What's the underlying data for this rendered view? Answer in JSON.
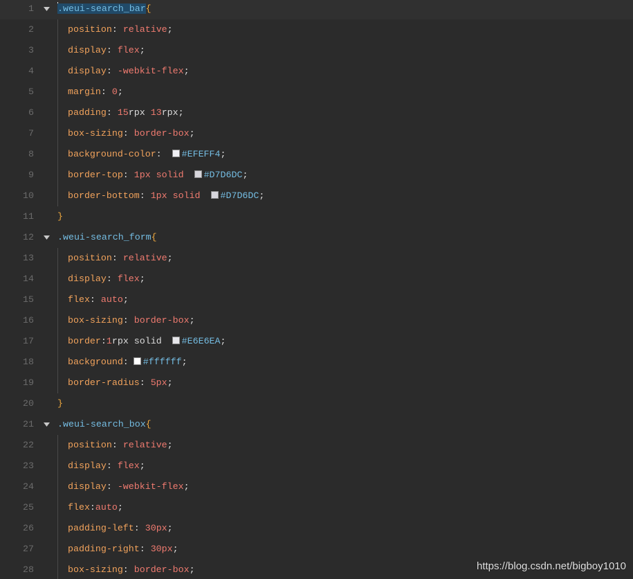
{
  "editor": {
    "theme": {
      "background": "#2b2b2b",
      "current_line": "#303030",
      "line_number": "#6b6b6b",
      "fold_arrow": "#c8c8c8",
      "indent_guide": "#4a4a4a",
      "selection": "#214a68",
      "tokens": {
        "selector": "#75bde3",
        "brace": "#efa93f",
        "property": "#f2a35c",
        "punctuation": "#dcdcdc",
        "value": "#f07b70",
        "number": "#f07b70",
        "text": "#dcdcdc",
        "color": "#75bde3"
      }
    },
    "lines": [
      {
        "n": 1,
        "fold": true,
        "indent": 0,
        "current": true,
        "cursor": true,
        "tokens": [
          {
            "k": "selector",
            "v": ".weui-search_bar",
            "selected": true
          },
          {
            "k": "brace",
            "v": "{"
          }
        ]
      },
      {
        "n": 2,
        "indent": 1,
        "tokens": [
          {
            "k": "property",
            "v": "position"
          },
          {
            "k": "punctuation",
            "v": ": "
          },
          {
            "k": "value",
            "v": "relative"
          },
          {
            "k": "punctuation",
            "v": ";"
          }
        ]
      },
      {
        "n": 3,
        "indent": 1,
        "tokens": [
          {
            "k": "property",
            "v": "display"
          },
          {
            "k": "punctuation",
            "v": ": "
          },
          {
            "k": "value",
            "v": "flex"
          },
          {
            "k": "punctuation",
            "v": ";"
          }
        ]
      },
      {
        "n": 4,
        "indent": 1,
        "tokens": [
          {
            "k": "property",
            "v": "display"
          },
          {
            "k": "punctuation",
            "v": ": "
          },
          {
            "k": "value",
            "v": "-webkit-flex"
          },
          {
            "k": "punctuation",
            "v": ";"
          }
        ]
      },
      {
        "n": 5,
        "indent": 1,
        "tokens": [
          {
            "k": "property",
            "v": "margin"
          },
          {
            "k": "punctuation",
            "v": ": "
          },
          {
            "k": "value",
            "v": "0"
          },
          {
            "k": "punctuation",
            "v": ";"
          }
        ]
      },
      {
        "n": 6,
        "indent": 1,
        "tokens": [
          {
            "k": "property",
            "v": "padding"
          },
          {
            "k": "punctuation",
            "v": ": "
          },
          {
            "k": "number",
            "v": "15"
          },
          {
            "k": "text",
            "v": "rpx "
          },
          {
            "k": "number",
            "v": "13"
          },
          {
            "k": "text",
            "v": "rpx"
          },
          {
            "k": "punctuation",
            "v": ";"
          }
        ]
      },
      {
        "n": 7,
        "indent": 1,
        "tokens": [
          {
            "k": "property",
            "v": "box-sizing"
          },
          {
            "k": "punctuation",
            "v": ": "
          },
          {
            "k": "value",
            "v": "border-box"
          },
          {
            "k": "punctuation",
            "v": ";"
          }
        ]
      },
      {
        "n": 8,
        "indent": 1,
        "tokens": [
          {
            "k": "property",
            "v": "background-color"
          },
          {
            "k": "punctuation",
            "v": ": "
          },
          {
            "k": "swatch",
            "color": "#EFEFF4"
          },
          {
            "k": "color",
            "v": "#EFEFF4"
          },
          {
            "k": "punctuation",
            "v": ";"
          }
        ]
      },
      {
        "n": 9,
        "indent": 1,
        "tokens": [
          {
            "k": "property",
            "v": "border-top"
          },
          {
            "k": "punctuation",
            "v": ": "
          },
          {
            "k": "value",
            "v": "1px solid"
          },
          {
            "k": "text",
            "v": " "
          },
          {
            "k": "swatch",
            "color": "#D7D6DC"
          },
          {
            "k": "color",
            "v": "#D7D6DC"
          },
          {
            "k": "punctuation",
            "v": ";"
          }
        ]
      },
      {
        "n": 10,
        "indent": 1,
        "tokens": [
          {
            "k": "property",
            "v": "border-bottom"
          },
          {
            "k": "punctuation",
            "v": ": "
          },
          {
            "k": "value",
            "v": "1px solid"
          },
          {
            "k": "text",
            "v": " "
          },
          {
            "k": "swatch",
            "color": "#D7D6DC"
          },
          {
            "k": "color",
            "v": "#D7D6DC"
          },
          {
            "k": "punctuation",
            "v": ";"
          }
        ]
      },
      {
        "n": 11,
        "indent": 0,
        "tokens": [
          {
            "k": "brace",
            "v": "}"
          }
        ]
      },
      {
        "n": 12,
        "fold": true,
        "indent": 0,
        "tokens": [
          {
            "k": "selector",
            "v": ".weui-search_form"
          },
          {
            "k": "brace",
            "v": "{"
          }
        ]
      },
      {
        "n": 13,
        "indent": 1,
        "tokens": [
          {
            "k": "property",
            "v": "position"
          },
          {
            "k": "punctuation",
            "v": ": "
          },
          {
            "k": "value",
            "v": "relative"
          },
          {
            "k": "punctuation",
            "v": ";"
          }
        ]
      },
      {
        "n": 14,
        "indent": 1,
        "tokens": [
          {
            "k": "property",
            "v": "display"
          },
          {
            "k": "punctuation",
            "v": ": "
          },
          {
            "k": "value",
            "v": "flex"
          },
          {
            "k": "punctuation",
            "v": ";"
          }
        ]
      },
      {
        "n": 15,
        "indent": 1,
        "tokens": [
          {
            "k": "property",
            "v": "flex"
          },
          {
            "k": "punctuation",
            "v": ": "
          },
          {
            "k": "value",
            "v": "auto"
          },
          {
            "k": "punctuation",
            "v": ";"
          }
        ]
      },
      {
        "n": 16,
        "indent": 1,
        "tokens": [
          {
            "k": "property",
            "v": "box-sizing"
          },
          {
            "k": "punctuation",
            "v": ": "
          },
          {
            "k": "value",
            "v": "border-box"
          },
          {
            "k": "punctuation",
            "v": ";"
          }
        ]
      },
      {
        "n": 17,
        "indent": 1,
        "tokens": [
          {
            "k": "property",
            "v": "border"
          },
          {
            "k": "punctuation",
            "v": ":"
          },
          {
            "k": "number",
            "v": "1"
          },
          {
            "k": "text",
            "v": "rpx solid "
          },
          {
            "k": "swatch",
            "color": "#E6E6EA"
          },
          {
            "k": "color",
            "v": "#E6E6EA"
          },
          {
            "k": "punctuation",
            "v": ";"
          }
        ]
      },
      {
        "n": 18,
        "indent": 1,
        "tokens": [
          {
            "k": "property",
            "v": "background"
          },
          {
            "k": "punctuation",
            "v": ":"
          },
          {
            "k": "swatch",
            "color": "#ffffff"
          },
          {
            "k": "color",
            "v": "#ffffff"
          },
          {
            "k": "punctuation",
            "v": ";"
          }
        ]
      },
      {
        "n": 19,
        "indent": 1,
        "tokens": [
          {
            "k": "property",
            "v": "border-radius"
          },
          {
            "k": "punctuation",
            "v": ": "
          },
          {
            "k": "value",
            "v": "5px"
          },
          {
            "k": "punctuation",
            "v": ";"
          }
        ]
      },
      {
        "n": 20,
        "indent": 0,
        "tokens": [
          {
            "k": "brace",
            "v": "}"
          }
        ]
      },
      {
        "n": 21,
        "fold": true,
        "indent": 0,
        "tokens": [
          {
            "k": "selector",
            "v": ".weui-search_box"
          },
          {
            "k": "brace",
            "v": "{"
          }
        ]
      },
      {
        "n": 22,
        "indent": 1,
        "tokens": [
          {
            "k": "property",
            "v": "position"
          },
          {
            "k": "punctuation",
            "v": ": "
          },
          {
            "k": "value",
            "v": "relative"
          },
          {
            "k": "punctuation",
            "v": ";"
          }
        ]
      },
      {
        "n": 23,
        "indent": 1,
        "tokens": [
          {
            "k": "property",
            "v": "display"
          },
          {
            "k": "punctuation",
            "v": ": "
          },
          {
            "k": "value",
            "v": "flex"
          },
          {
            "k": "punctuation",
            "v": ";"
          }
        ]
      },
      {
        "n": 24,
        "indent": 1,
        "tokens": [
          {
            "k": "property",
            "v": "display"
          },
          {
            "k": "punctuation",
            "v": ": "
          },
          {
            "k": "value",
            "v": "-webkit-flex"
          },
          {
            "k": "punctuation",
            "v": ";"
          }
        ]
      },
      {
        "n": 25,
        "indent": 1,
        "tokens": [
          {
            "k": "property",
            "v": "flex"
          },
          {
            "k": "punctuation",
            "v": ":"
          },
          {
            "k": "value",
            "v": "auto"
          },
          {
            "k": "punctuation",
            "v": ";"
          }
        ]
      },
      {
        "n": 26,
        "indent": 1,
        "tokens": [
          {
            "k": "property",
            "v": "padding-left"
          },
          {
            "k": "punctuation",
            "v": ": "
          },
          {
            "k": "value",
            "v": "30px"
          },
          {
            "k": "punctuation",
            "v": ";"
          }
        ]
      },
      {
        "n": 27,
        "indent": 1,
        "tokens": [
          {
            "k": "property",
            "v": "padding-right"
          },
          {
            "k": "punctuation",
            "v": ": "
          },
          {
            "k": "value",
            "v": "30px"
          },
          {
            "k": "punctuation",
            "v": ";"
          }
        ]
      },
      {
        "n": 28,
        "indent": 1,
        "tokens": [
          {
            "k": "property",
            "v": "box-sizing"
          },
          {
            "k": "punctuation",
            "v": ": "
          },
          {
            "k": "value",
            "v": "border-box"
          },
          {
            "k": "punctuation",
            "v": ";"
          }
        ]
      }
    ]
  },
  "watermark": "https://blog.csdn.net/bigboy1010"
}
